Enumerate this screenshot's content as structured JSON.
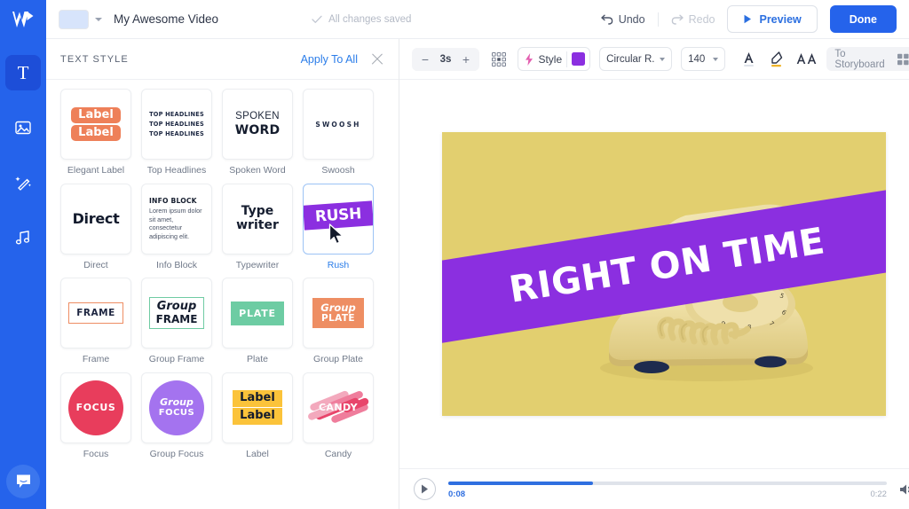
{
  "app": {
    "logo_icon": "wave-logo-icon",
    "accent": "#2563eb"
  },
  "topbar": {
    "thumbnail_icon": "project-thumbnail",
    "caret_icon": "chevron-down-icon",
    "title": "My Awesome Video",
    "saved_icon": "check-icon",
    "saved_text": "All changes saved",
    "undo_icon": "undo-icon",
    "undo_label": "Undo",
    "redo_icon": "redo-icon",
    "redo_label": "Redo",
    "preview_icon": "play-triangle-icon",
    "preview_label": "Preview",
    "done_label": "Done"
  },
  "rail": {
    "items": [
      {
        "name": "text",
        "icon": "text-t-icon",
        "active": true
      },
      {
        "name": "media",
        "icon": "image-icon",
        "active": false
      },
      {
        "name": "effects",
        "icon": "magic-wand-icon",
        "active": false
      },
      {
        "name": "audio",
        "icon": "music-note-icon",
        "active": false
      }
    ],
    "help_icon": "chat-bubble-icon"
  },
  "panel": {
    "title": "TEXT STYLE",
    "apply_all_label": "Apply To All",
    "close_icon": "close-icon",
    "selected": "Rush",
    "styles": [
      {
        "label": "Elegant Label",
        "art": "elegant-label",
        "text": [
          "Label",
          "Label"
        ]
      },
      {
        "label": "Top Headlines",
        "art": "top-headlines",
        "text": [
          "TOP HEADLINES",
          "TOP HEADLINES",
          "TOP HEADLINES"
        ]
      },
      {
        "label": "Spoken Word",
        "art": "spoken-word",
        "text": [
          "SPOKEN",
          "WORD"
        ]
      },
      {
        "label": "Swoosh",
        "art": "swoosh",
        "text": [
          "SWOOSH"
        ]
      },
      {
        "label": "Direct",
        "art": "direct",
        "text": [
          "Direct"
        ]
      },
      {
        "label": "Info Block",
        "art": "info-block",
        "text": [
          "INFO BLOCK",
          "Lorem ipsum dolor sit amet, consectetur adipiscing elit."
        ]
      },
      {
        "label": "Typewriter",
        "art": "typewriter",
        "text": [
          "Type",
          "writer"
        ]
      },
      {
        "label": "Rush",
        "art": "rush",
        "text": [
          "RUSH"
        ]
      },
      {
        "label": "Frame",
        "art": "frame",
        "text": [
          "FRAME"
        ]
      },
      {
        "label": "Group Frame",
        "art": "group-frame",
        "text": [
          "Group",
          "FRAME"
        ]
      },
      {
        "label": "Plate",
        "art": "plate",
        "text": [
          "PLATE"
        ]
      },
      {
        "label": "Group Plate",
        "art": "group-plate",
        "text": [
          "Group",
          "PLATE"
        ]
      },
      {
        "label": "Focus",
        "art": "focus",
        "text": [
          "FOCUS"
        ]
      },
      {
        "label": "Group Focus",
        "art": "group-focus",
        "text": [
          "Group",
          "FOCUS"
        ]
      },
      {
        "label": "Label",
        "art": "label",
        "text": [
          "Label",
          "Label"
        ]
      },
      {
        "label": "Candy",
        "art": "candy",
        "text": [
          "CANDY"
        ]
      }
    ],
    "colors": {
      "elegant_label": "#ee8059",
      "rush": "#8b2fe0",
      "frame": "#ee8d63",
      "group_frame": "#6fcba3",
      "plate": "#6dcca3",
      "group_plate": "#ee8e63",
      "focus": "#e83d5c",
      "group_focus": "#a473ef",
      "label": "#fbc33a",
      "candy": "#e8456b"
    }
  },
  "toolbar": {
    "duration_minus": "−",
    "duration_value": "3s",
    "duration_plus": "+",
    "position_icon": "position-grid-icon",
    "style_icon": "lightning-icon",
    "style_label": "Style",
    "style_color": "#8b2fe0",
    "font_name": "Circular R...",
    "font_size": "140",
    "text_color_icon": "text-color-a-icon",
    "highlight_icon": "highlighter-pen-icon",
    "case_icon": "text-case-aa-icon",
    "storyboard_label": "To Storyboard",
    "storyboard_icon": "storyboard-grid-icon"
  },
  "canvas": {
    "background_color": "#e2cf6f",
    "banner_color": "#8b2fe0",
    "banner_text": "RIGHT ON TIME",
    "subject": "vintage-rotary-telephone"
  },
  "player": {
    "play_icon": "play-icon",
    "current_time": "0:08",
    "total_time": "0:22",
    "progress_percent": 33,
    "volume_icon": "volume-icon"
  }
}
